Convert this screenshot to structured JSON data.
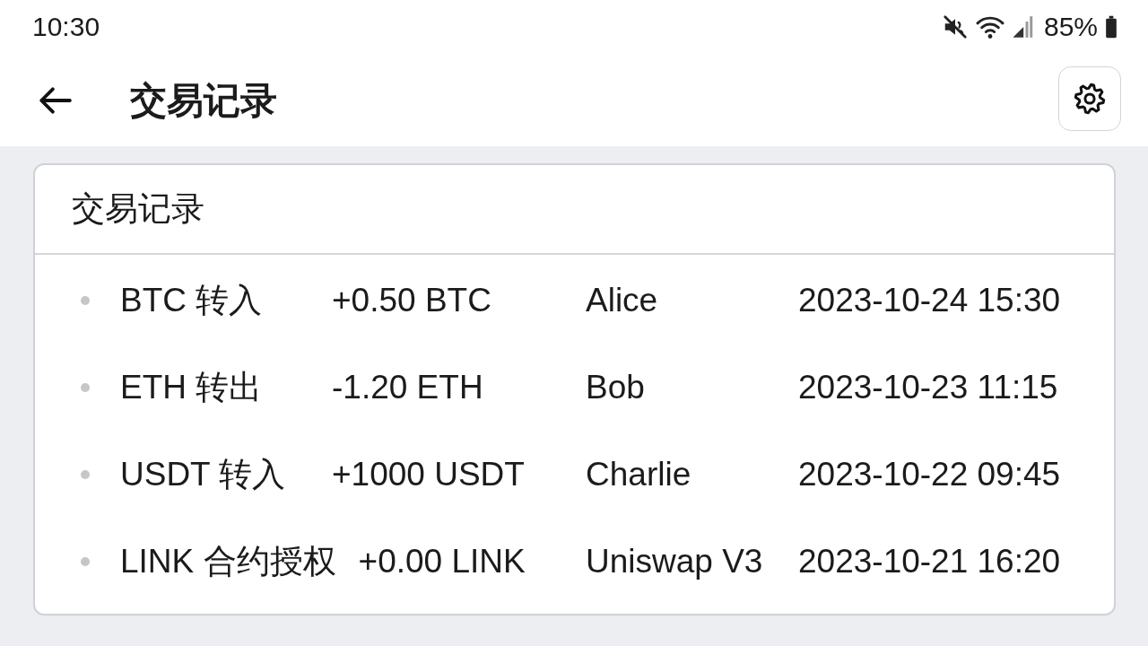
{
  "status_bar": {
    "time": "10:30",
    "battery": "85%"
  },
  "app_bar": {
    "title": "交易记录"
  },
  "card": {
    "title": "交易记录",
    "rows": [
      {
        "type": "BTC 转入",
        "amount": "+0.50 BTC",
        "counterparty": "Alice",
        "time": "2023-10-24 15:30"
      },
      {
        "type": "ETH 转出",
        "amount": "-1.20 ETH",
        "counterparty": "Bob",
        "time": "2023-10-23 11:15"
      },
      {
        "type": "USDT 转入",
        "amount": "+1000 USDT",
        "counterparty": "Charlie",
        "time": "2023-10-22 09:45"
      },
      {
        "type": "LINK 合约授权",
        "amount": "+0.00 LINK",
        "counterparty": "Uniswap V3",
        "time": "2023-10-21 16:20"
      }
    ]
  }
}
